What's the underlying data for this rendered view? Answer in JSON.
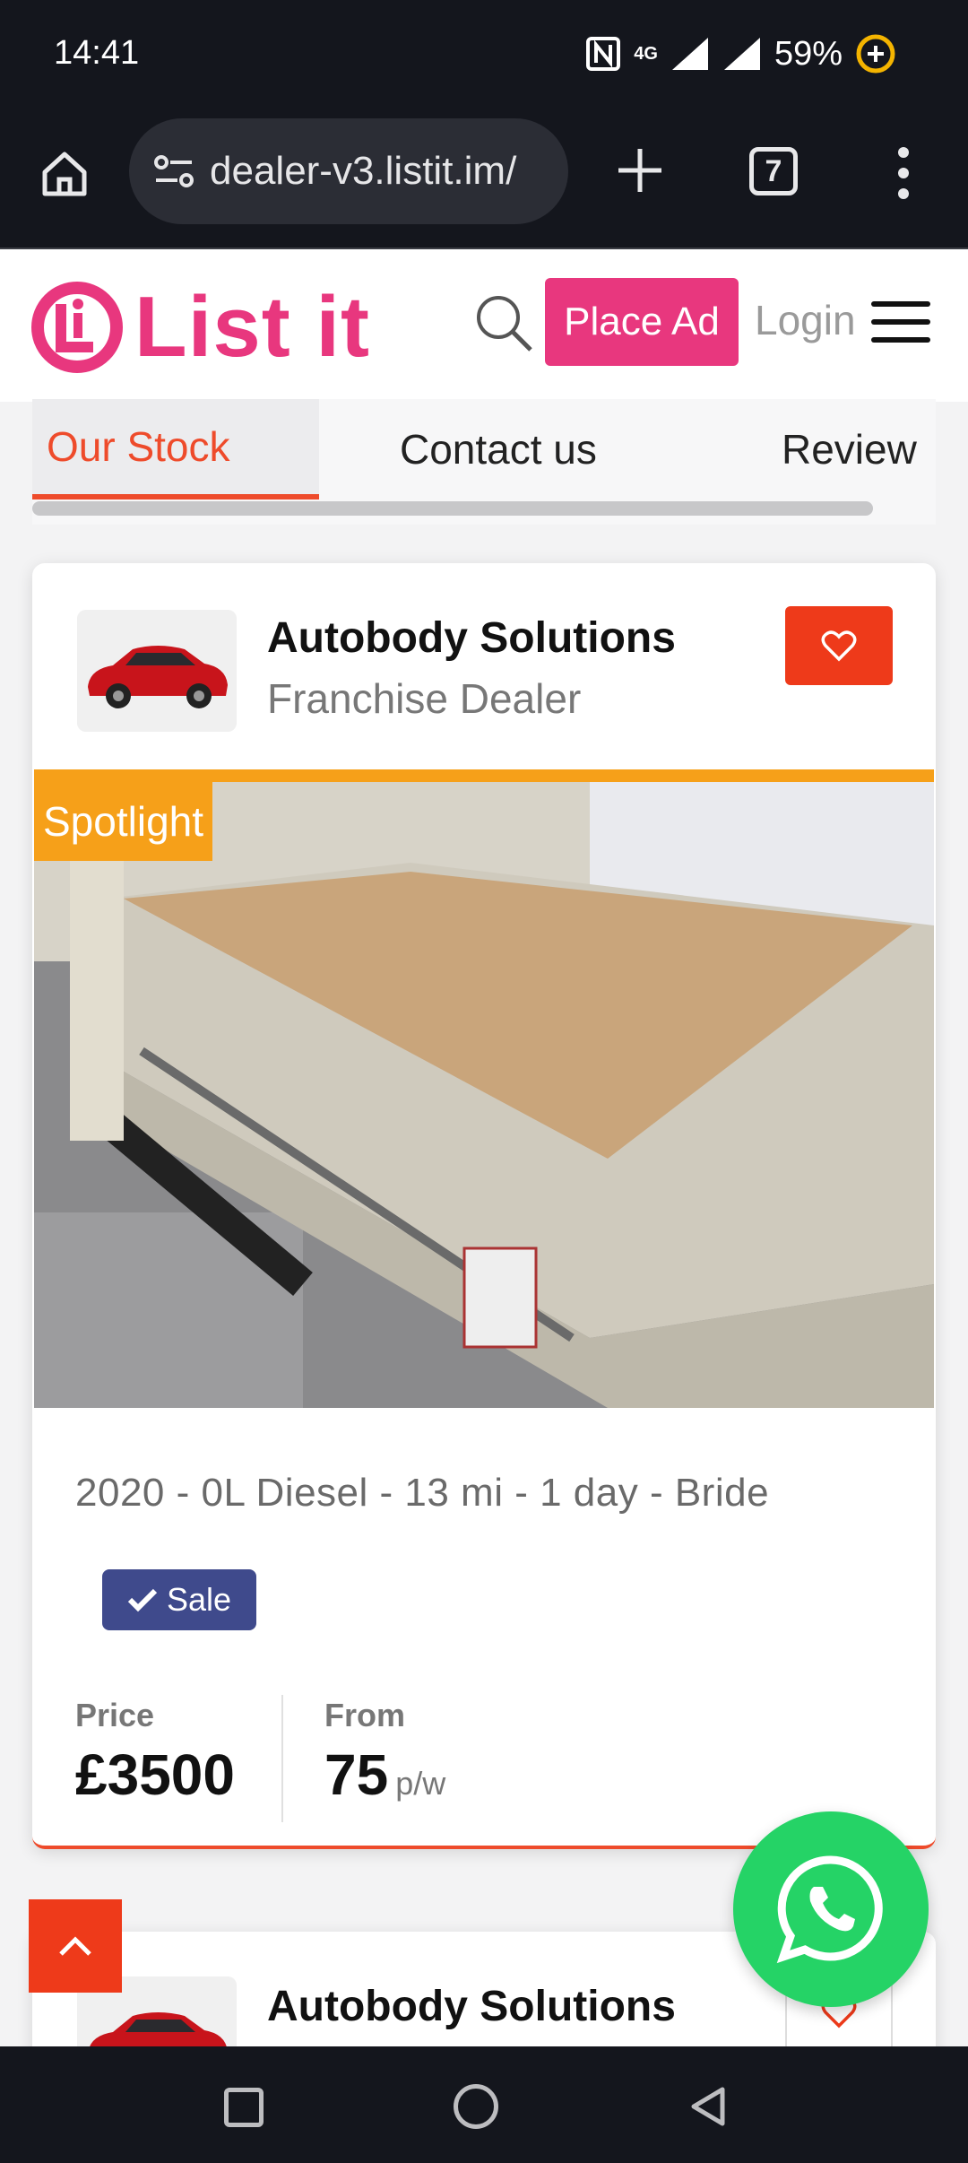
{
  "status_bar": {
    "time": "14:41",
    "network": "4G",
    "battery": "59%"
  },
  "browser": {
    "url": "dealer-v3.listit.im/",
    "tab_count": "7"
  },
  "header": {
    "logo_text": "List it",
    "place_ad_label": "Place Ad",
    "login_label": "Login"
  },
  "tabs": {
    "items": [
      {
        "label": "Our Stock",
        "active": true
      },
      {
        "label": "Contact us",
        "active": false
      },
      {
        "label": "Review",
        "active": false
      }
    ]
  },
  "listing": {
    "dealer_name": "Autobody Solutions",
    "dealer_type": "Franchise Dealer",
    "badge": "Spotlight",
    "specs": "2020 - 0L Diesel - 13 mi - 1 day - Bride",
    "sale_label": "Sale",
    "price_label": "Price",
    "price_value": "£3500",
    "from_label": "From",
    "from_value": "75",
    "from_unit": "p/w"
  },
  "listing2": {
    "dealer_name": "Autobody Solutions"
  },
  "colors": {
    "brand_pink": "#e8377e",
    "accent_red": "#ee3a1a",
    "spotlight_orange": "#f6a019",
    "sale_badge": "#3f4a8c",
    "whatsapp_green": "#25d366"
  }
}
